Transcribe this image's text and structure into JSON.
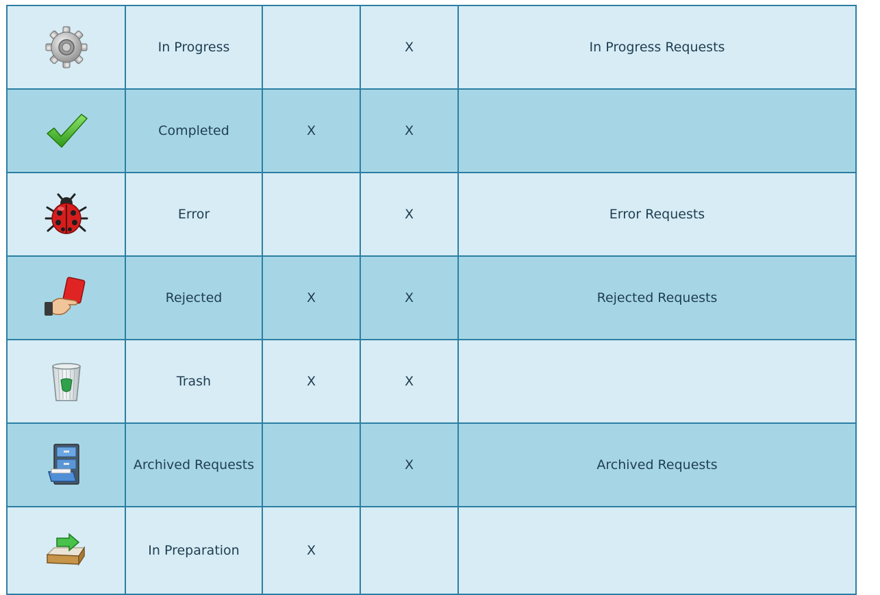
{
  "rows": [
    {
      "icon": "gear-icon",
      "status": "In Progress",
      "col3": "",
      "col4": "X",
      "link": "In Progress Requests",
      "shade": "light"
    },
    {
      "icon": "checkmark-icon",
      "status": "Completed",
      "col3": "X",
      "col4": "X",
      "link": "",
      "shade": "dark"
    },
    {
      "icon": "ladybug-icon",
      "status": "Error",
      "col3": "",
      "col4": "X",
      "link": "Error Requests",
      "shade": "light"
    },
    {
      "icon": "red-card-icon",
      "status": "Rejected",
      "col3": "X",
      "col4": "X",
      "link": "Rejected Requests",
      "shade": "dark"
    },
    {
      "icon": "trash-bin-icon",
      "status": "Trash",
      "col3": "X",
      "col4": "X",
      "link": "",
      "shade": "light"
    },
    {
      "icon": "filing-cabinet-icon",
      "status": "Archived Requests",
      "col3": "",
      "col4": "X",
      "link": "Archived Requests",
      "shade": "dark"
    },
    {
      "icon": "inbox-tray-icon",
      "status": "In Preparation",
      "col3": "X",
      "col4": "",
      "link": "",
      "shade": "light"
    }
  ],
  "colors": {
    "row_light": "#d7ecf4",
    "row_dark": "#a6d6e5",
    "border": "#2b7ea3",
    "text": "#1f3d52"
  }
}
